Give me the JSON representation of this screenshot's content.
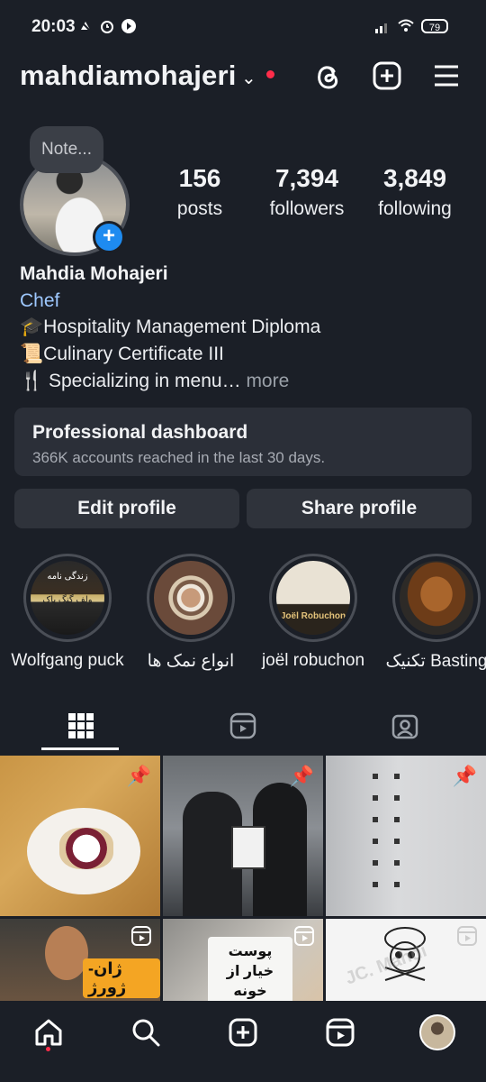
{
  "status_bar": {
    "time": "20:03",
    "battery": "79"
  },
  "header": {
    "username": "mahdiamohajeri"
  },
  "profile": {
    "note": "Note...",
    "name": "Mahdia Mohajeri",
    "category": "Chef",
    "bio": [
      "🎓Hospitality Management Diploma",
      "📜Culinary Certificate III",
      "🍴 Specializing in menu…"
    ],
    "more": "more"
  },
  "stats": [
    {
      "value": "156",
      "label": "posts"
    },
    {
      "value": "7,394",
      "label": "followers"
    },
    {
      "value": "3,849",
      "label": "following"
    }
  ],
  "dashboard": {
    "title": "Professional dashboard",
    "subtitle": "366K accounts reached in the last 30 days."
  },
  "buttons": {
    "edit": "Edit profile",
    "share": "Share profile"
  },
  "highlights": [
    {
      "label": "Wolfgang puck",
      "cover_text_1": "زندگی نامه",
      "cover_text_2": "ولف گنگ پاک"
    },
    {
      "label": "انواع نمک ها"
    },
    {
      "label": "joël robuchon",
      "cover_text": "Joël Robuchon"
    },
    {
      "label": "تکنیک Basting"
    }
  ],
  "grid_posts": [
    {
      "type": "pinned"
    },
    {
      "type": "pinned"
    },
    {
      "type": "pinned"
    },
    {
      "type": "reel",
      "overlay": "ژان-ژورژ"
    },
    {
      "type": "reel",
      "overlay": "پوست خیار از خونه"
    },
    {
      "type": "reel",
      "overlay": "JC. Mahdi"
    }
  ],
  "icons": {
    "threads": "threads-icon",
    "new_post": "plus-square-icon",
    "menu": "hamburger-menu-icon",
    "tab_grid": "grid-icon",
    "tab_reels": "reels-icon",
    "tab_tagged": "tagged-icon",
    "nav": [
      "home-icon",
      "search-icon",
      "create-icon",
      "reels-icon",
      "profile-avatar"
    ]
  },
  "colors": {
    "background": "#1b1f27",
    "link": "#9ec8ff",
    "notification_dot": "#ff2d4a",
    "accent_blue": "#1e8bf0"
  }
}
